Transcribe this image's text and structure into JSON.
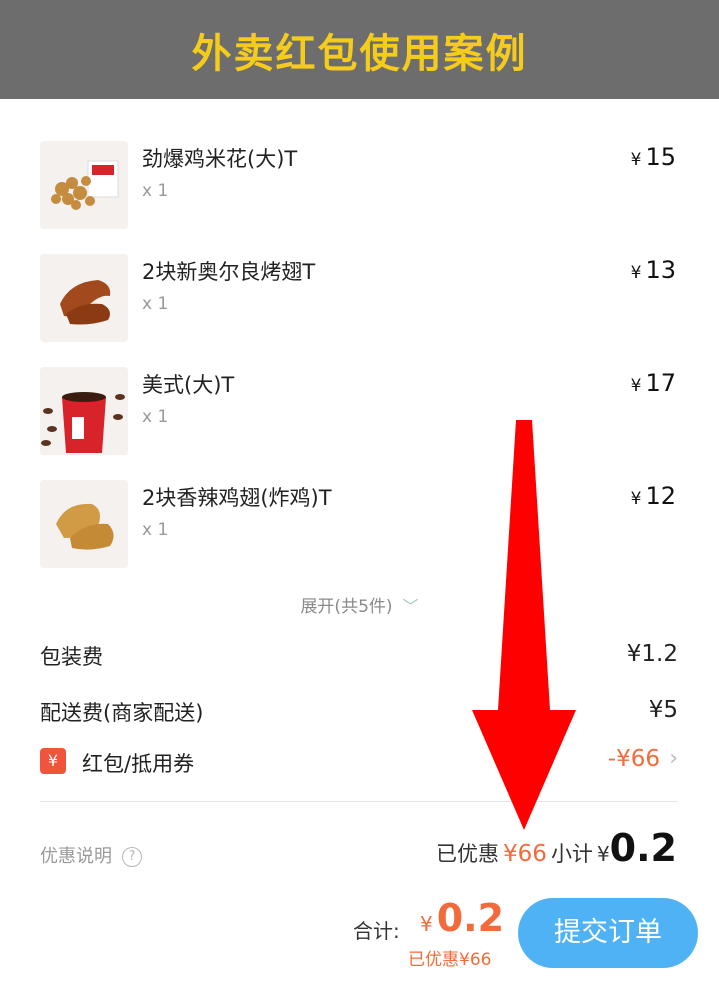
{
  "header": {
    "title": "外卖红包使用案例"
  },
  "items": [
    {
      "name": "劲爆鸡米花(大)T",
      "qty": "x 1",
      "currency": "¥",
      "price": "15"
    },
    {
      "name": "2块新奥尔良烤翅T",
      "qty": "x 1",
      "currency": "¥",
      "price": "13"
    },
    {
      "name": "美式(大)T",
      "qty": "x 1",
      "currency": "¥",
      "price": "17"
    },
    {
      "name": "2块香辣鸡翅(炸鸡)T",
      "qty": "x 1",
      "currency": "¥",
      "price": "12"
    }
  ],
  "expand": {
    "label": "展开(共5件)"
  },
  "fees": {
    "packaging": {
      "label": "包装费",
      "value": "¥1.2"
    },
    "delivery": {
      "label": "配送费(商家配送)",
      "value": "¥5"
    }
  },
  "coupon": {
    "badge": "¥",
    "label": "红包/抵用券",
    "value": "-¥66"
  },
  "promo": {
    "label": "优惠说明",
    "icon_text": "?"
  },
  "subtotal": {
    "saved_label": "已优惠",
    "saved_value": "¥66",
    "label": "小计",
    "currency": "¥",
    "amount": "0.2"
  },
  "total": {
    "label": "合计:",
    "currency": "¥",
    "amount": "0.2",
    "saved": "已优惠¥66"
  },
  "submit": {
    "label": "提交订单"
  },
  "colors": {
    "accent": "#f46b3b",
    "button": "#4eb2f4",
    "header_bg": "#6d6d6d",
    "header_text": "#f6cc1c",
    "arrow": "#ff0000"
  }
}
